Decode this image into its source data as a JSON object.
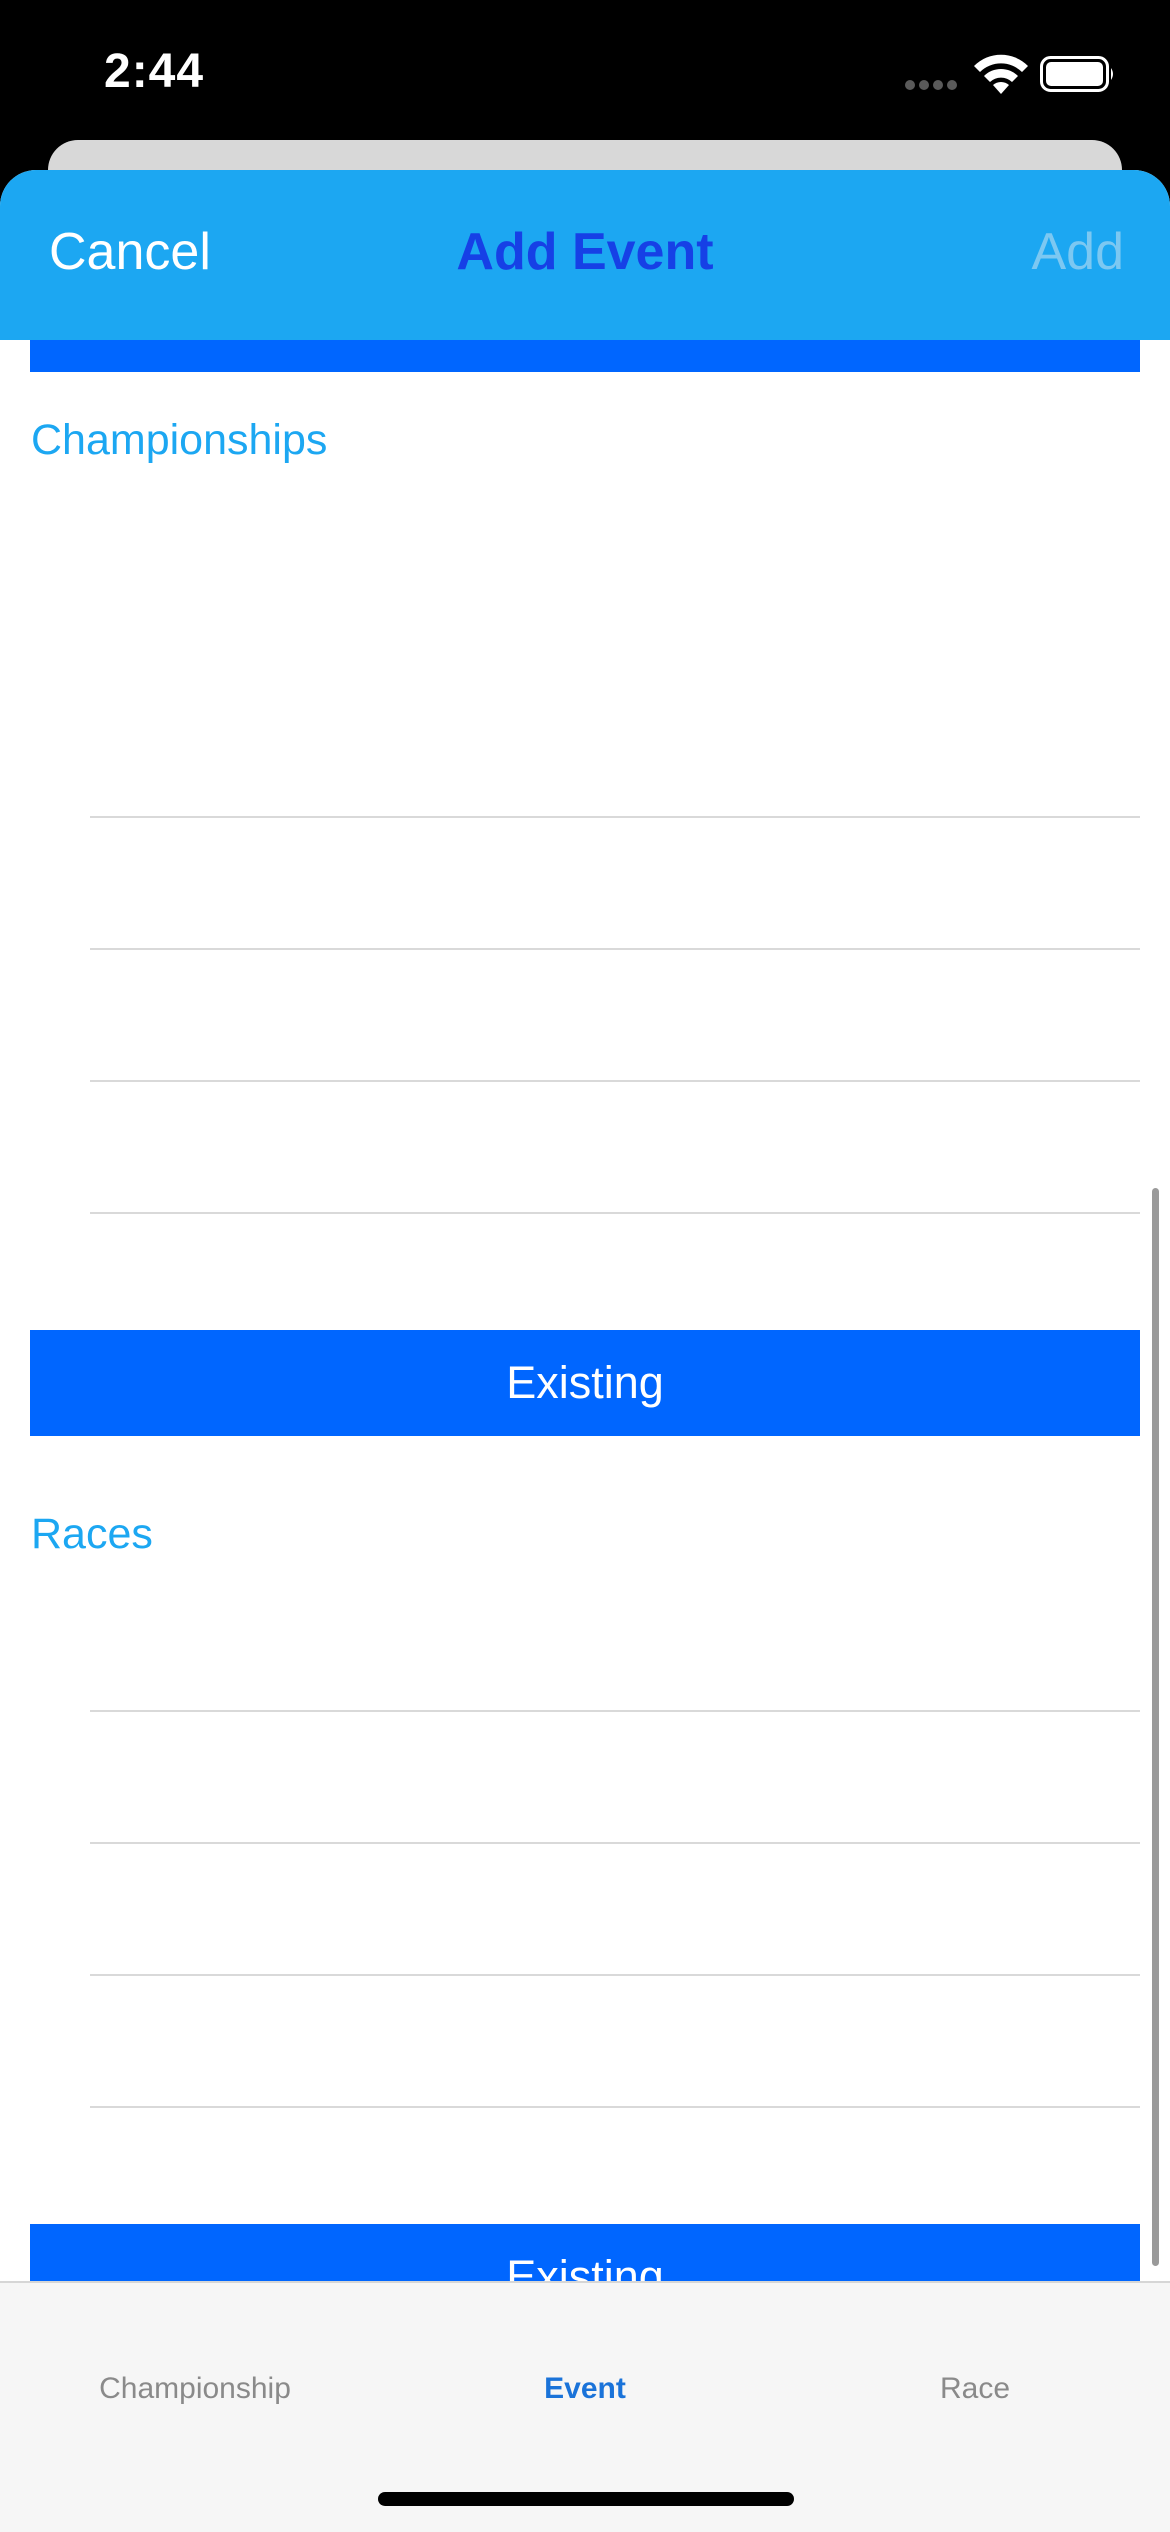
{
  "status_bar": {
    "time": "2:44"
  },
  "navbar": {
    "cancel_label": "Cancel",
    "title": "Add Event",
    "add_label": "Add",
    "background_color": "#1ca7f2",
    "title_color": "#1640e6"
  },
  "sections": [
    {
      "header": "Championships",
      "button_label": "Existing"
    },
    {
      "header": "Races",
      "button_label": "Existing"
    }
  ],
  "tabbar": {
    "tabs": [
      {
        "label": "Championship",
        "selected": false
      },
      {
        "label": "Event",
        "selected": true
      },
      {
        "label": "Race",
        "selected": false
      }
    ]
  },
  "colors": {
    "accent_blue": "#0066ff",
    "section_header": "#1ca7f2"
  },
  "icons": [
    "wifi-icon",
    "battery-icon",
    "signal-dots-icon"
  ]
}
